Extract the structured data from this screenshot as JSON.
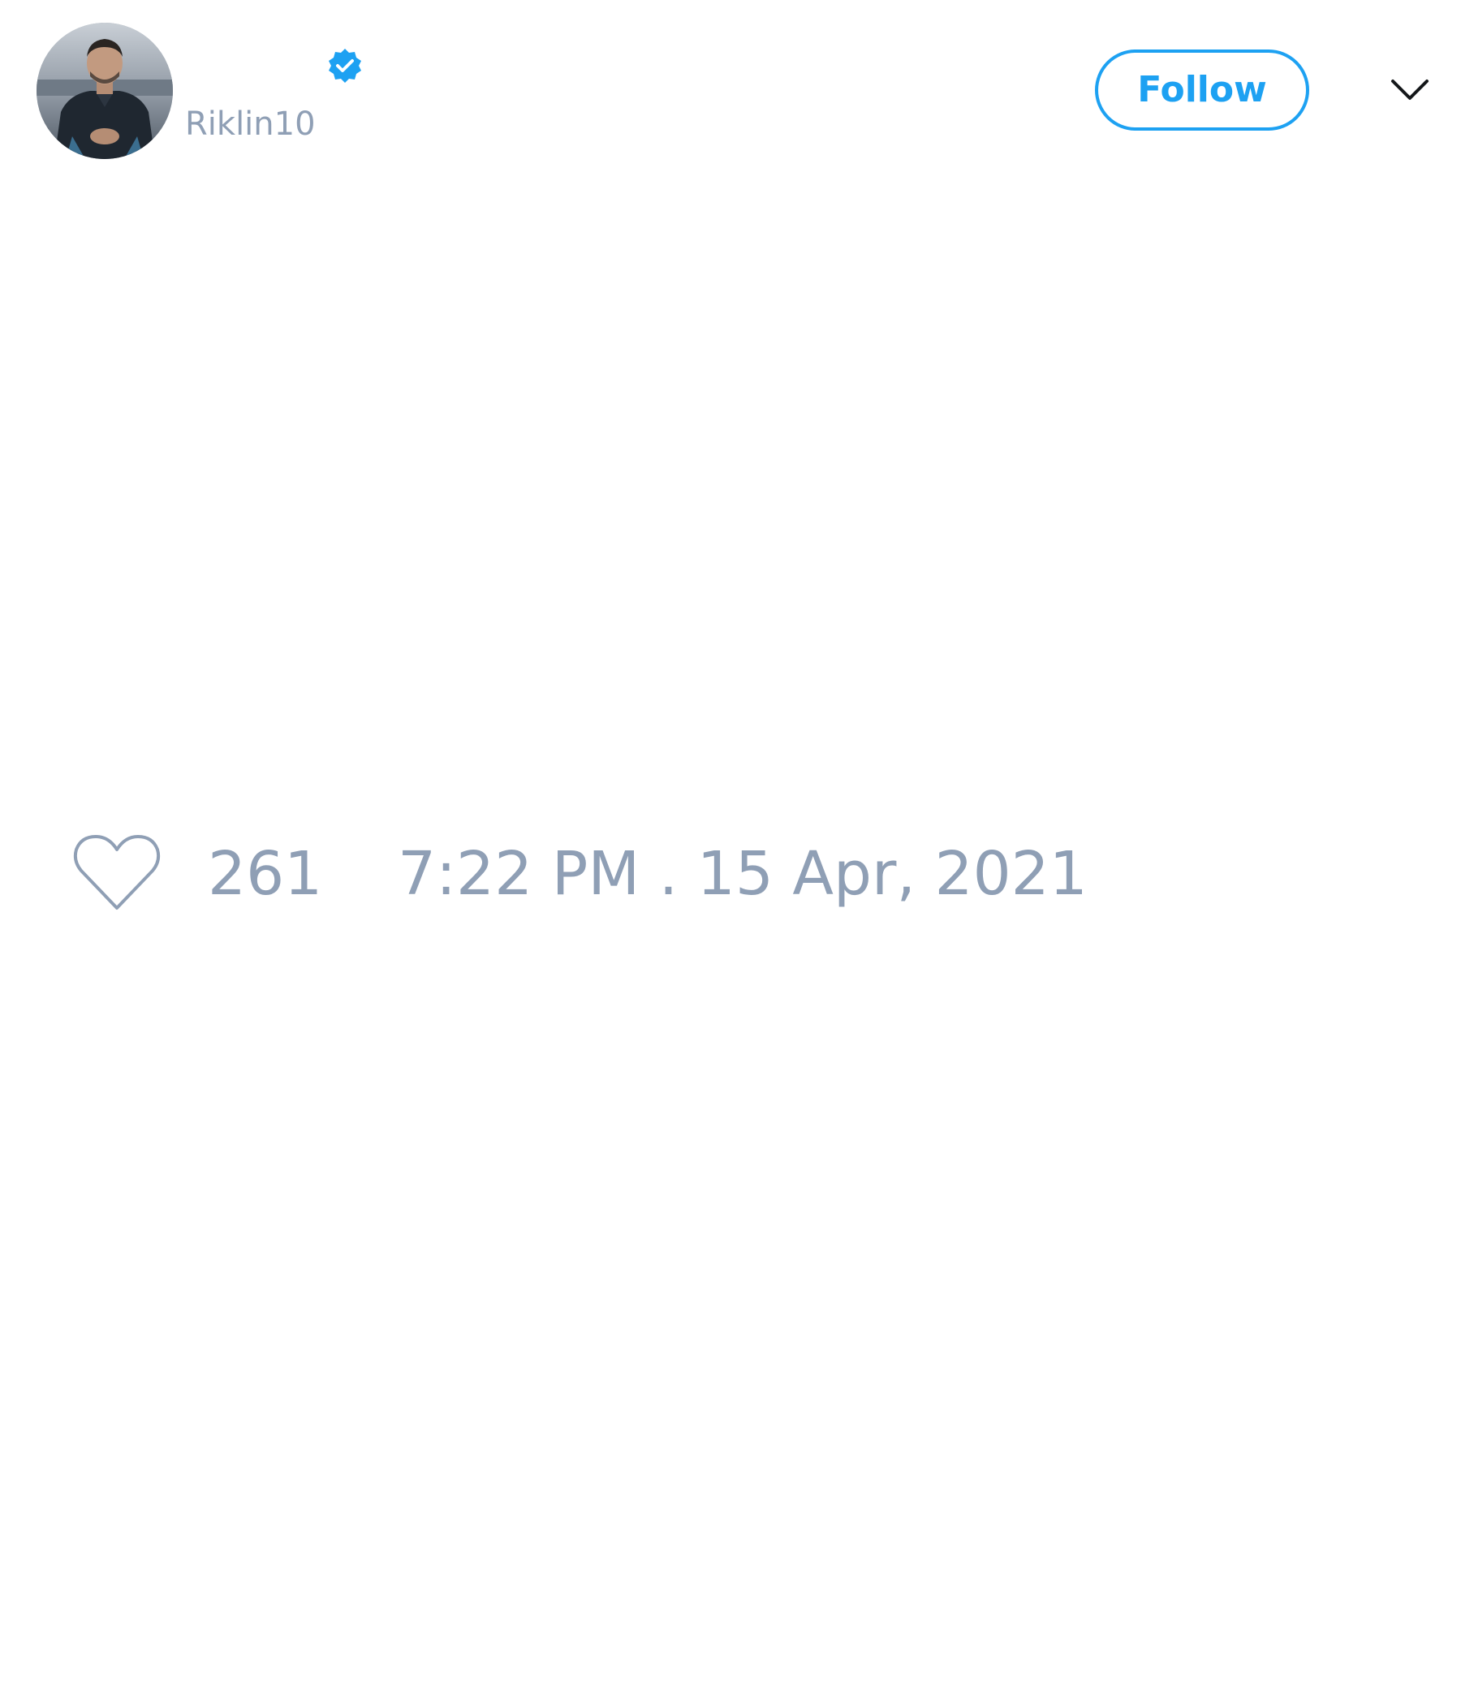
{
  "tweet": {
    "author": {
      "display_name": "",
      "handle": "Riklin10",
      "verified": true,
      "avatar": "profile-photo"
    },
    "follow_label": "Follow",
    "menu_icon": "chevron-down-icon",
    "like_icon": "heart-outline-icon",
    "likes": "261",
    "timestamp": "7:22 PM . 15 Apr, 2021"
  },
  "colors": {
    "accent": "#1da1f2",
    "muted_text": "#8f9fb5",
    "background": "#ffffff"
  }
}
